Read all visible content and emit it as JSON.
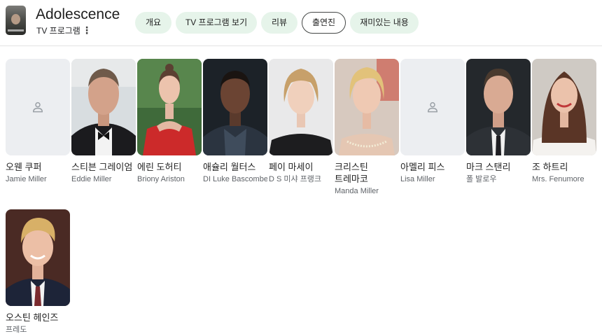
{
  "header": {
    "title": "Adolescence",
    "subtitle": "TV 프로그램",
    "more_icon": "⋮",
    "tabs": [
      {
        "label": "개요",
        "active": false
      },
      {
        "label": "TV 프로그램 보기",
        "active": false
      },
      {
        "label": "리뷰",
        "active": false
      },
      {
        "label": "출연진",
        "active": true
      },
      {
        "label": "재미있는 내용",
        "active": false
      }
    ]
  },
  "cast": [
    {
      "name": "오웬 쿠퍼",
      "role": "Jamie Miller",
      "photo": "placeholder"
    },
    {
      "name": "스티븐 그레이엄",
      "role": "Eddie Miller",
      "photo": "man-suit-bowtie"
    },
    {
      "name": "에린 도허티",
      "role": "Briony Ariston",
      "photo": "woman-red-dress"
    },
    {
      "name": "애슐리 월터스",
      "role": "DI Luke Bascombe",
      "photo": "man-jacket"
    },
    {
      "name": "페이 마세이",
      "role": "D S 미샤 프랭크",
      "photo": "woman-bob"
    },
    {
      "name": "크리스틴 트레마코",
      "role": "Manda Miller",
      "photo": "woman-blonde"
    },
    {
      "name": "아멜리 피스",
      "role": "Lisa Miller",
      "photo": "placeholder"
    },
    {
      "name": "마크 스탠리",
      "role": "폴 발로우",
      "photo": "man-suit-tie"
    },
    {
      "name": "조 하트리",
      "role": "Mrs. Fenumore",
      "photo": "woman-brunette"
    },
    {
      "name": "오스틴 헤인즈",
      "role": "프레도",
      "photo": "boy-blonde"
    }
  ],
  "colors": {
    "chip_bg": "#e6f4ea",
    "chip_active_border": "#444746",
    "placeholder_bg": "#eceef1",
    "placeholder_icon": "#9aa0a6"
  }
}
